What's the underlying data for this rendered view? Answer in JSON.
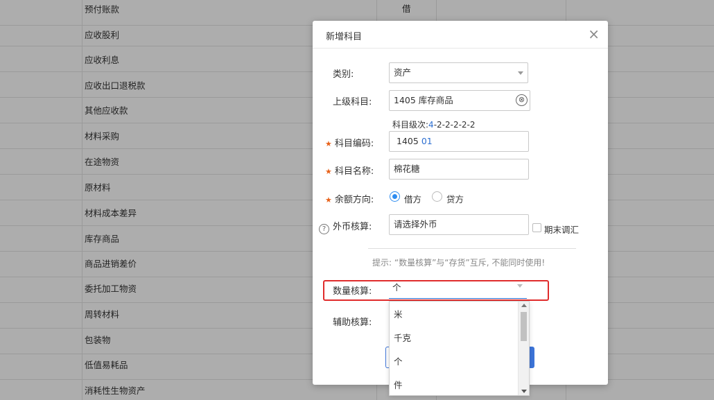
{
  "table": {
    "rows": [
      {
        "name": "预付账款",
        "direction": "借"
      },
      {
        "name": "应收股利",
        "direction": ""
      },
      {
        "name": "应收利息",
        "direction": ""
      },
      {
        "name": "应收出口退税款",
        "direction": ""
      },
      {
        "name": "其他应收款",
        "direction": ""
      },
      {
        "name": "材料采购",
        "direction": ""
      },
      {
        "name": "在途物资",
        "direction": ""
      },
      {
        "name": "原材料",
        "direction": ""
      },
      {
        "name": "材料成本差异",
        "direction": ""
      },
      {
        "name": "库存商品",
        "direction": ""
      },
      {
        "name": "商品进销差价",
        "direction": ""
      },
      {
        "name": "委托加工物资",
        "direction": ""
      },
      {
        "name": "周转材料",
        "direction": ""
      },
      {
        "name": "包装物",
        "direction": ""
      },
      {
        "name": "低值易耗品",
        "direction": ""
      },
      {
        "name": "消耗性生物资产",
        "direction": ""
      }
    ]
  },
  "dialog": {
    "title": "新增科目",
    "close_icon": "×",
    "category": {
      "label": "类别:",
      "value": "资产"
    },
    "parent": {
      "label": "上级科目:",
      "value": "1405 库存商品",
      "clear_icon": "⊗"
    },
    "level_hint": {
      "prefix": "科目级次:",
      "first": "4",
      "rest": "-2-2-2-2-2"
    },
    "code": {
      "label": "科目编码:",
      "prefix": "1405",
      "suffix": "01"
    },
    "name": {
      "label": "科目名称:",
      "value": "棉花糖"
    },
    "balance": {
      "label": "余额方向:",
      "debit": "借方",
      "credit": "贷方",
      "selected": "借方"
    },
    "currency": {
      "label": "外币核算:",
      "placeholder": "请选择外币",
      "period_end": "期末调汇"
    },
    "tip": "提示: “数量核算”与“存货”互斥, 不能同时使用!",
    "quantity": {
      "label": "数量核算:",
      "value": "个"
    },
    "auxiliary": {
      "label": "辅助核算:"
    },
    "dropdown": {
      "options": [
        "米",
        "千克",
        "个",
        "件"
      ]
    }
  },
  "colors": {
    "accent": "#2d8cf0",
    "required_star": "#e8621a",
    "highlight": "#e02b2b",
    "link_blue": "#2d6fd1"
  }
}
